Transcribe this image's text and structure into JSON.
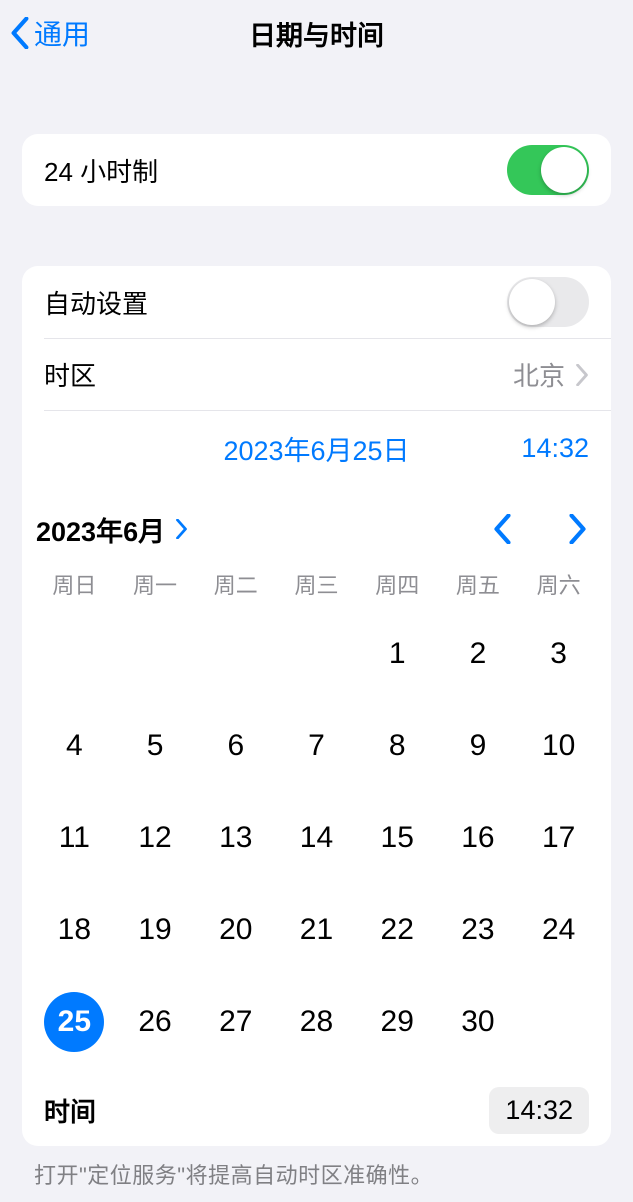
{
  "nav": {
    "back": "通用",
    "title": "日期与时间"
  },
  "hour24": {
    "label": "24 小时制",
    "on": true
  },
  "auto": {
    "label": "自动设置",
    "on": false
  },
  "tz": {
    "label": "时区",
    "value": "北京"
  },
  "datetime_display": {
    "date": "2023年6月25日",
    "time": "14:32"
  },
  "calendar": {
    "month_label": "2023年6月",
    "weekdays": [
      "周日",
      "周一",
      "周二",
      "周三",
      "周四",
      "周五",
      "周六"
    ],
    "first_day_index": 4,
    "num_days": 30,
    "selected": 25
  },
  "time_row": {
    "label": "时间",
    "value": "14:32"
  },
  "footer": "打开\"定位服务\"将提高自动时区准确性。"
}
